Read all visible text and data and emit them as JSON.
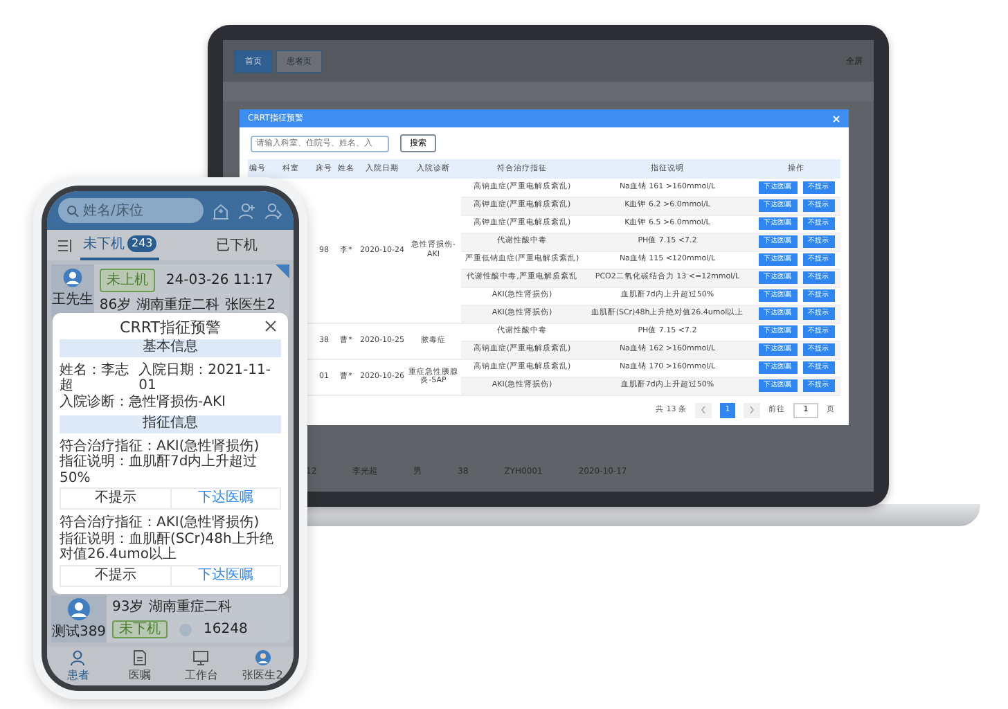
{
  "laptop": {
    "nav_tabs": [
      {
        "label": "首页",
        "selected": true
      },
      {
        "label": "患者页",
        "selected": false
      }
    ],
    "fullscreen": "全屏",
    "background_row": [
      "12",
      "李光超",
      "男",
      "38",
      "ZYH0001",
      "2020-10-17"
    ],
    "dialog": {
      "title": "CRRT指征预警",
      "search": {
        "placeholder": "请输入科室、住院号、姓名、入"
      },
      "search_button": "搜索",
      "columns": [
        "编号",
        "科室",
        "床号",
        "姓名",
        "入院日期",
        "入院诊断",
        "符合治疗指征",
        "指征说明",
        "操作"
      ],
      "patients": [
        {
          "bed": "98",
          "name": "李*",
          "admit_date": "2020-10-24",
          "diagnosis": "急性肾损伤-AKI",
          "indications": [
            {
              "indication": "高钠血症(严重电解质紊乱)",
              "description": "Na血钠 161 >160mmol/L",
              "order_button": "下达医嘱",
              "dismiss_button": "不提示"
            },
            {
              "indication": "高钾血症(严重电解质紊乱)",
              "description": "K血钾 6.2 >6.0mmol/L",
              "order_button": "下达医嘱",
              "dismiss_button": "不提示"
            },
            {
              "indication": "高钾血症(严重电解质紊乱)",
              "description": "K血钾 6.5 >6.0mmol/L",
              "order_button": "下达医嘱",
              "dismiss_button": "不提示"
            },
            {
              "indication": "代谢性酸中毒",
              "description": "PH值 7.15 <7.2",
              "order_button": "下达医嘱",
              "dismiss_button": "不提示"
            },
            {
              "indication": "严重低钠血症(严重电解质紊乱)",
              "description": "Na血钠 115 <120mmol/L",
              "order_button": "下达医嘱",
              "dismiss_button": "不提示"
            },
            {
              "indication": "代谢性酸中毒,严重电解质紊乱",
              "description": "PCO2二氧化碳结合力 13 <=12mmol/L",
              "order_button": "下达医嘱",
              "dismiss_button": "不提示"
            },
            {
              "indication": "AKI(急性肾损伤)",
              "description": "血肌酐7d内上升超过50%",
              "order_button": "下达医嘱",
              "dismiss_button": "不提示"
            },
            {
              "indication": "AKI(急性肾损伤)",
              "description": "血肌酐(SCr)48h上升绝对值26.4umol以上",
              "order_button": "下达医嘱",
              "dismiss_button": "不提示"
            }
          ]
        },
        {
          "bed": "38",
          "name": "曹*",
          "admit_date": "2020-10-25",
          "diagnosis": "脓毒症",
          "indications": [
            {
              "indication": "代谢性酸中毒",
              "description": "PH值 7.15 <7.2",
              "order_button": "下达医嘱",
              "dismiss_button": "不提示"
            },
            {
              "indication": "高钠血症(严重电解质紊乱)",
              "description": "Na血钠 162 >160mmol/L",
              "order_button": "下达医嘱",
              "dismiss_button": "不提示"
            }
          ]
        },
        {
          "bed": "01",
          "name": "曹*",
          "admit_date": "2020-10-26",
          "diagnosis": "重症急性胰腺炎-SAP",
          "indications": [
            {
              "indication": "高钠血症(严重电解质紊乱)",
              "description": "Na血钠 170 >160mmol/L",
              "order_button": "下达医嘱",
              "dismiss_button": "不提示"
            },
            {
              "indication": "AKI(急性肾损伤)",
              "description": "血肌酐7d内上升超过50%",
              "order_button": "下达医嘱",
              "dismiss_button": "不提示"
            }
          ]
        }
      ],
      "pagination": {
        "total": "共 13 条",
        "pages": [
          {
            "label": "1",
            "selected": true
          }
        ],
        "goto_label": "前往",
        "goto_value": "1",
        "page_suffix": "页"
      }
    }
  },
  "phone": {
    "search": {
      "placeholder": "姓名/床位"
    },
    "tabs": [
      {
        "label": "未下机",
        "badge": "243",
        "selected": true
      },
      {
        "label": "已下机",
        "selected": false
      }
    ],
    "patients": [
      {
        "name": "王先生",
        "status": "未上机",
        "time": "24-03-26 11:17",
        "age": "86岁",
        "ward": "湖南重症二科",
        "doctor": "张医生2"
      },
      {
        "name": "测试389",
        "status": "未下机",
        "age": "93岁",
        "ward": "湖南重症二科",
        "number": "16248"
      }
    ],
    "alert": {
      "title": "CRRT指征预警",
      "basic_heading": "基本信息",
      "name_line": "姓名：李志超",
      "admit_line": "入院日期：2021-11-01",
      "diagnosis_line": "入院诊断：急性肾损伤-AKI",
      "indication_heading": "指征信息",
      "indications": [
        {
          "indication": "符合治疗指征：AKI(急性肾损伤)",
          "description": "指征说明：血肌酐7d内上升超过50%",
          "dismiss_button": "不提示",
          "order_button": "下达医嘱"
        },
        {
          "indication": "符合治疗指征：AKI(急性肾损伤)",
          "description": "指征说明：血肌酐(SCr)48h上升绝对值26.4umo以上",
          "dismiss_button": "不提示",
          "order_button": "下达医嘱"
        }
      ]
    },
    "bottom_nav": [
      {
        "kind": "patient",
        "label": "患者",
        "selected": true
      },
      {
        "kind": "orders",
        "label": "医嘱",
        "selected": false
      },
      {
        "kind": "workbench",
        "label": "工作台",
        "selected": false
      },
      {
        "kind": "profile",
        "label": "张医生2",
        "selected": false
      }
    ]
  }
}
